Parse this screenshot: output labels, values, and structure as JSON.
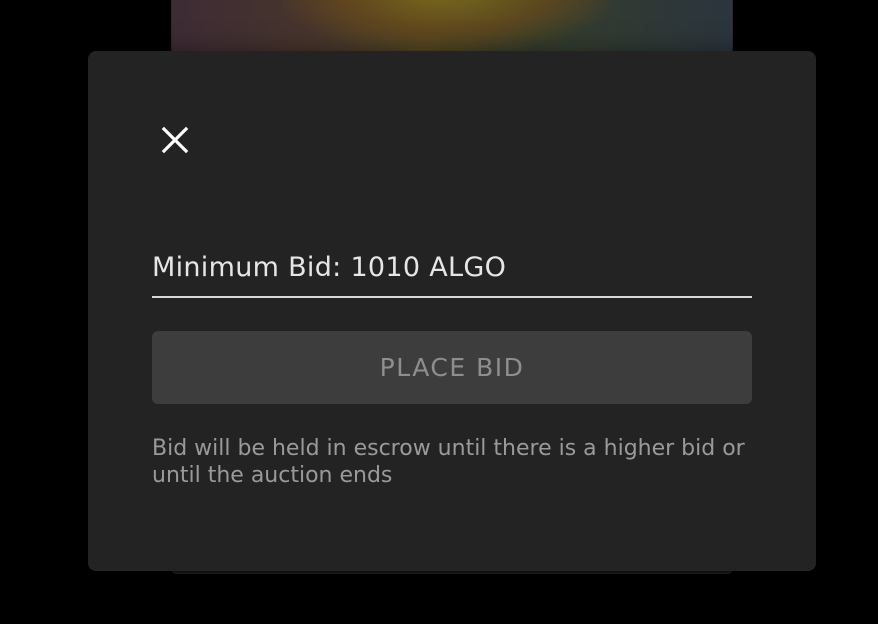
{
  "modal": {
    "close_icon": "close-icon",
    "bid_input": {
      "placeholder": "Minimum Bid: 1010 ALGO",
      "value": ""
    },
    "place_bid_label": "PLACE BID",
    "escrow_note": "Bid will be held in escrow until there is a higher bid or until the auction ends"
  },
  "colors": {
    "modal_bg": "#232323",
    "button_bg": "#3d3d3d",
    "button_text": "#8e8e8e",
    "input_text": "#e6e6e6",
    "note_text": "#9a9a9a",
    "overlay": "#000000"
  }
}
